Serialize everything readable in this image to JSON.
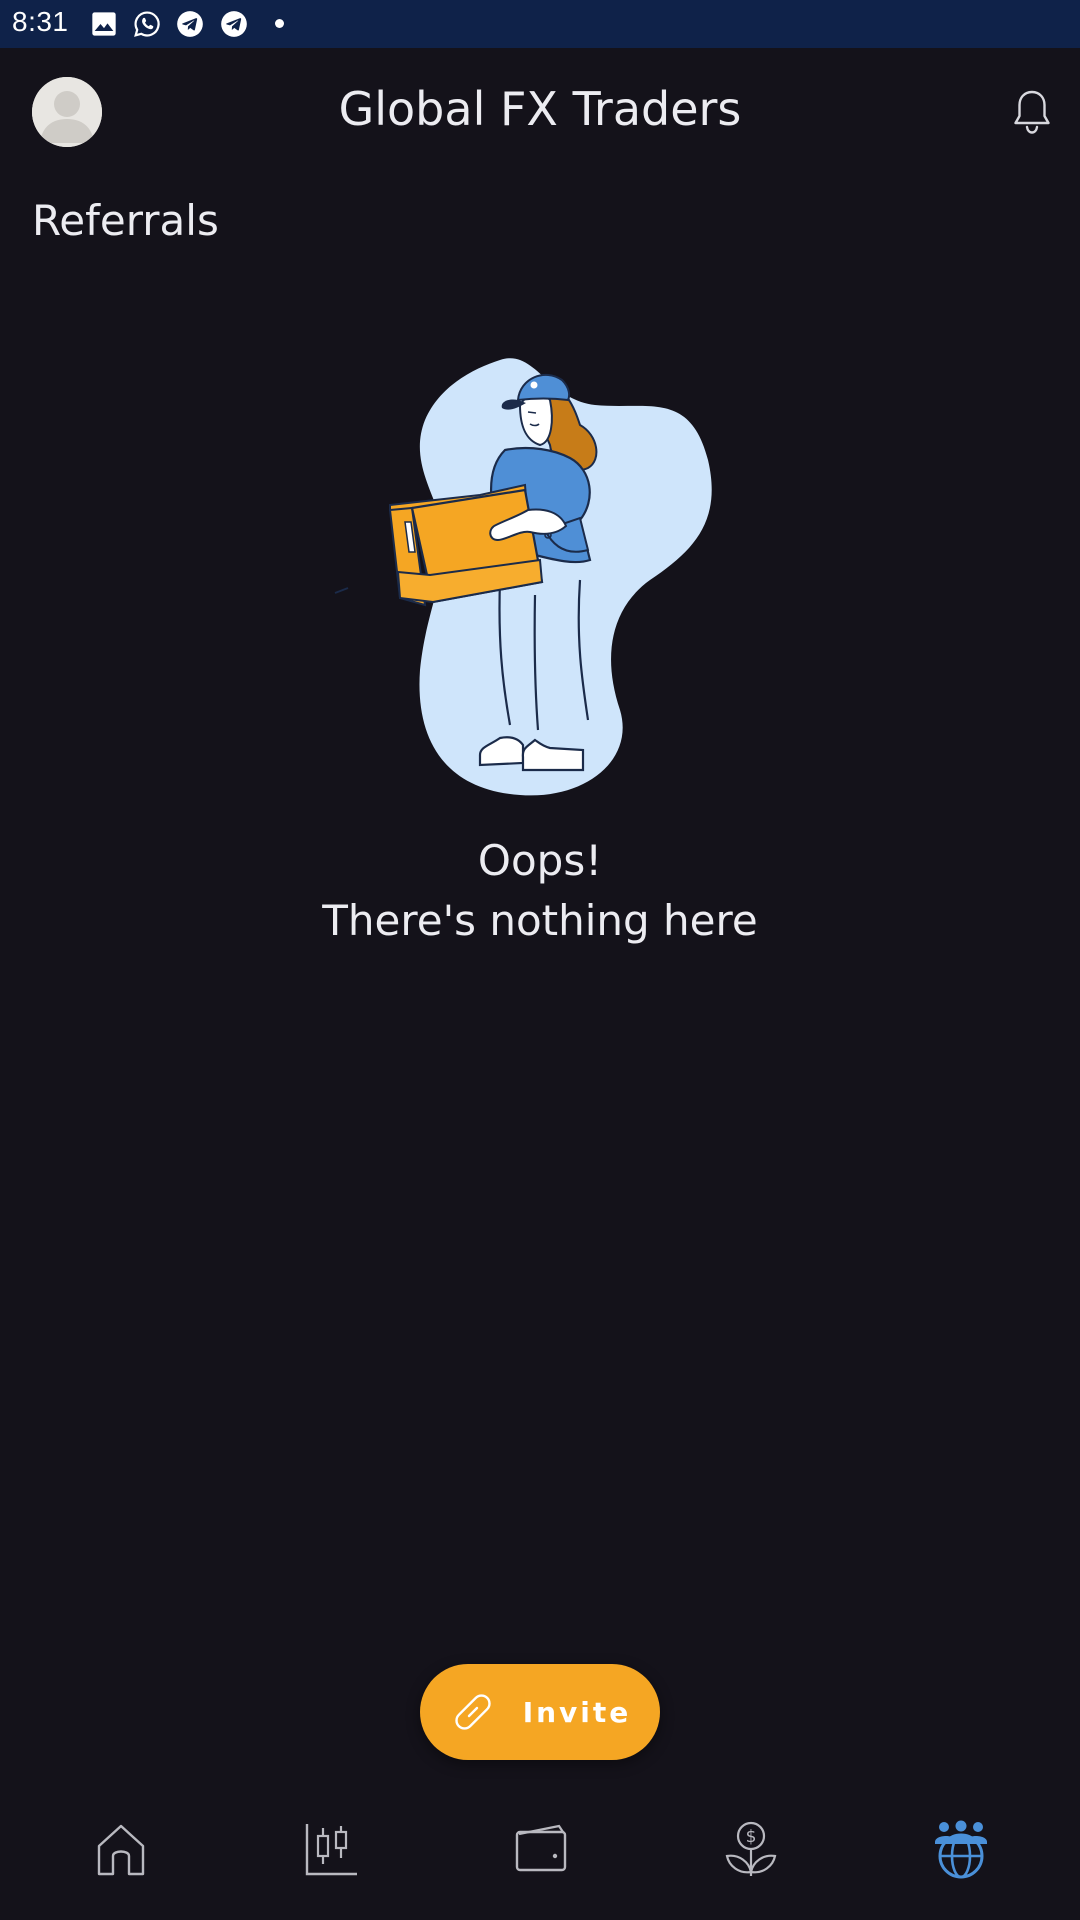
{
  "status_bar": {
    "time": "8:31",
    "icons": [
      "gallery-icon",
      "whatsapp-icon",
      "telegram-icon",
      "telegram-icon",
      "notification-dot"
    ]
  },
  "header": {
    "title": "Global FX Traders",
    "avatar_icon": "user-avatar",
    "notification_icon": "bell-icon"
  },
  "section": {
    "title": "Referrals"
  },
  "empty_state": {
    "title": "Oops!",
    "subtitle": "There's nothing here",
    "illustration": "person-holding-box"
  },
  "invite_button": {
    "label": "Invite",
    "icon": "link-icon"
  },
  "bottom_nav": {
    "items": [
      {
        "name": "home",
        "icon": "home-icon",
        "active": false
      },
      {
        "name": "markets",
        "icon": "candlestick-chart-icon",
        "active": false
      },
      {
        "name": "wallet",
        "icon": "wallet-icon",
        "active": false
      },
      {
        "name": "invest",
        "icon": "money-plant-icon",
        "active": false
      },
      {
        "name": "referrals",
        "icon": "community-globe-icon",
        "active": true
      }
    ]
  },
  "colors": {
    "background": "#14121a",
    "status_bar": "#0f2249",
    "accent": "#f5a623",
    "active_nav": "#4a90d9",
    "inactive_nav": "#b9b9c0",
    "text": "#ececf1"
  }
}
